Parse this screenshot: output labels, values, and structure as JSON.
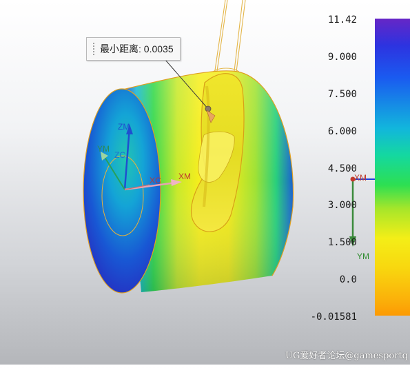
{
  "measurement": {
    "label": "最小距离",
    "value": "0.0035"
  },
  "scale": {
    "ticks": [
      "11.42",
      "9.000",
      "7.500",
      "6.000",
      "4.500",
      "3.000",
      "1.500",
      "0.0",
      "-0.01581"
    ]
  },
  "axes": {
    "zm": "ZM",
    "ym": "YM",
    "zc": "ZC",
    "xc": "XC",
    "xm": "XM",
    "csys_xm": "XM",
    "csys_ym": "YM"
  },
  "watermark": "UG爱好者论坛@gamesportq",
  "colors": {
    "axis_x": "#c0392b",
    "axis_y": "#2e8b2e",
    "axis_z": "#1f4fd0",
    "csys_x": "#1f3fdd",
    "outline": "#e0a020"
  }
}
